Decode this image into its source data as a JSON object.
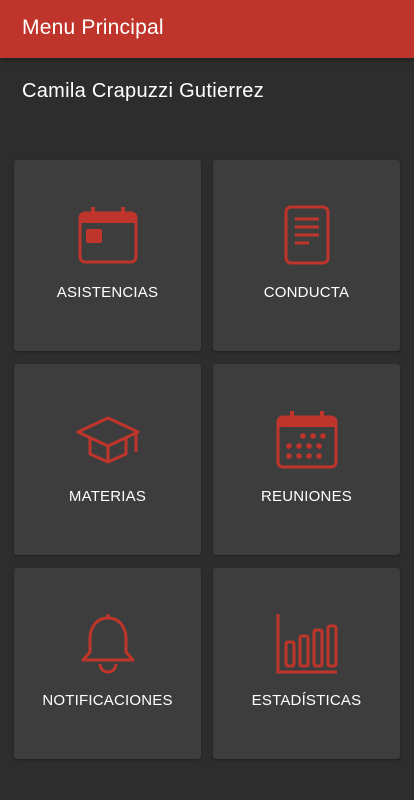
{
  "header": {
    "title": "Menu Principal"
  },
  "user": {
    "name": "Camila Crapuzzi Gutierrez"
  },
  "accent_color": "#c0352b",
  "tiles": [
    {
      "label": "ASISTENCIAS",
      "icon": "calendar-day-icon"
    },
    {
      "label": "CONDUCTA",
      "icon": "document-icon"
    },
    {
      "label": "MATERIAS",
      "icon": "graduation-cap-icon"
    },
    {
      "label": "REUNIONES",
      "icon": "calendar-grid-icon"
    },
    {
      "label": "NOTIFICACIONES",
      "icon": "bell-icon"
    },
    {
      "label": "ESTADÍSTICAS",
      "icon": "bar-chart-icon"
    }
  ]
}
